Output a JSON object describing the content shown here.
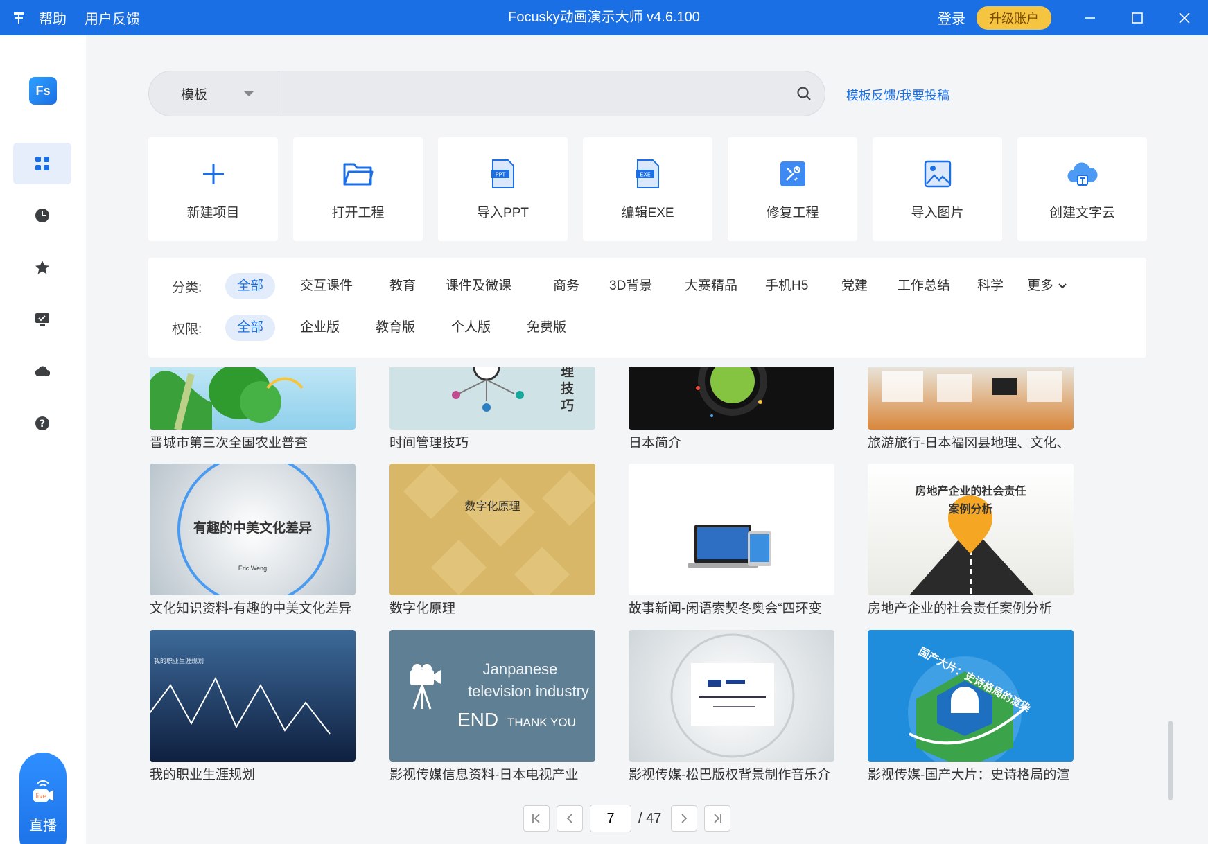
{
  "titlebar": {
    "menu": [
      "帮助",
      "用户反馈"
    ],
    "title": "Focusky动画演示大师 v4.6.100",
    "login": "登录",
    "upgrade": "升级账户"
  },
  "sidebar": {
    "logo": "Fs",
    "items": [
      "grid-icon",
      "clock-icon",
      "star-icon",
      "monitor-check-icon",
      "cloud-icon",
      "help-icon"
    ],
    "live_label": "直播",
    "live_badge": "live"
  },
  "search": {
    "select_value": "模板",
    "placeholder": "",
    "feedback_link": "模板反馈/我要投稿"
  },
  "actions": [
    {
      "label": "新建项目",
      "icon": "plus-icon"
    },
    {
      "label": "打开工程",
      "icon": "folder-icon"
    },
    {
      "label": "导入PPT",
      "icon": "ppt-file-icon",
      "badge": "PPT"
    },
    {
      "label": "编辑EXE",
      "icon": "exe-file-icon",
      "badge": "EXE"
    },
    {
      "label": "修复工程",
      "icon": "repair-icon"
    },
    {
      "label": "导入图片",
      "icon": "image-icon"
    },
    {
      "label": "创建文字云",
      "icon": "cloud-text-icon"
    }
  ],
  "filter": {
    "category_label": "分类:",
    "categories": [
      "全部",
      "交互课件",
      "教育",
      "课件及微课",
      "商务",
      "3D背景",
      "大赛精品",
      "手机H5",
      "党建",
      "工作总结",
      "科学",
      "更多"
    ],
    "permission_label": "权限:",
    "permissions": [
      "全部",
      "企业版",
      "教育版",
      "个人版",
      "免费版"
    ]
  },
  "templates": [
    {
      "title": "晋城市第三次全国农业普查"
    },
    {
      "title": "时间管理技巧",
      "thumb_text": "理 技 巧"
    },
    {
      "title": "日本简介"
    },
    {
      "title": "旅游旅行-日本福冈县地理、文化、"
    },
    {
      "title": "文化知识资料-有趣的中美文化差异",
      "thumb_text": "有趣的中美文化差异",
      "thumb_sub": "Eric Weng"
    },
    {
      "title": "数字化原理",
      "thumb_text": "数字化原理"
    },
    {
      "title": "故事新闻-闲语索契冬奥会“四环变"
    },
    {
      "title": "房地产企业的社会责任案例分析",
      "thumb_text": "房地产企业的社会责任",
      "thumb_sub": "案例分析"
    },
    {
      "title": "我的职业生涯规划",
      "thumb_text": "我的职业生涯规划"
    },
    {
      "title": "影视传媒信息资料-日本电视产业",
      "thumb_text": "Janpanese",
      "thumb_sub": "television industry",
      "thumb_end": "END",
      "thumb_thanks": "THANK YOU"
    },
    {
      "title": "影视传媒-松巴版权背景制作音乐介"
    },
    {
      "title": "影视传媒-国产大片：史诗格局的渲",
      "thumb_text": "国产大片：史诗格局的渲染"
    }
  ],
  "pager": {
    "current": "7",
    "total": "/ 47"
  }
}
